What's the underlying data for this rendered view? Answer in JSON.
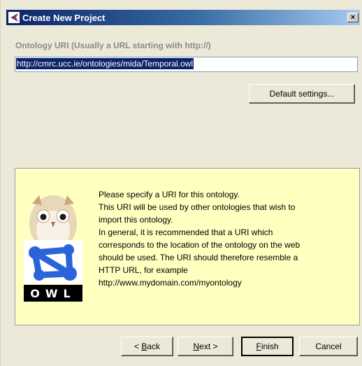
{
  "window": {
    "title": "Create New Project",
    "close_label": "×"
  },
  "uri": {
    "label": "Ontology URI (Usually a URL starting with http://)",
    "value": "http://cmrc.ucc.ie/ontologies/mida/Temporal.owl"
  },
  "buttons": {
    "default_settings": "Default settings...",
    "back_prefix": "< ",
    "back_key": "B",
    "back_rest": "ack",
    "next_key": "N",
    "next_rest": "ext >",
    "finish_key": "F",
    "finish_rest": "inish",
    "cancel": "Cancel"
  },
  "info": {
    "logo_text": "OWL",
    "lines": [
      "Please specify a URI for this ontology.",
      "This URI will be used by other ontologies that wish to",
      "import this ontology.",
      "In general, it is recommended that a URI which",
      "corresponds to the location of the ontology on the web",
      "should be used. The URI should therefore resemble a",
      "HTTP URL, for example",
      "http://www.mydomain.com/myontology"
    ]
  },
  "colors": {
    "title_bar": "#0a246a",
    "info_background": "#ffffc0",
    "selection": "#0a246a"
  }
}
